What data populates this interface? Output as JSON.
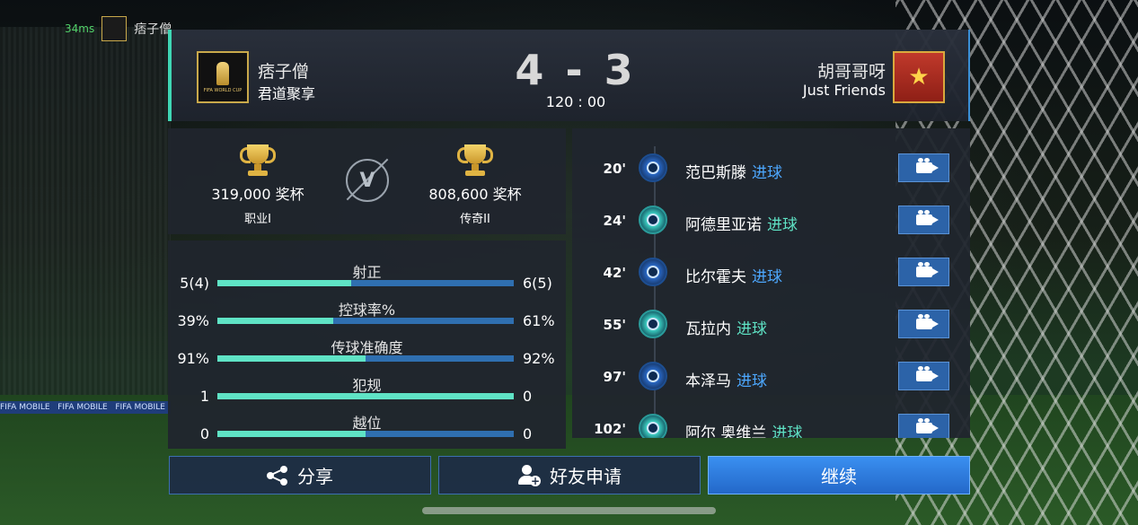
{
  "status": {
    "ping": "34ms",
    "mini_player": "痞子僧"
  },
  "match": {
    "home": {
      "name": "痞子僧",
      "club": "君道聚享",
      "logo_icon": "world-cup-icon"
    },
    "away": {
      "name": "胡哥哥呀",
      "club": "Just Friends",
      "logo_icon": "red-star-crest-icon"
    },
    "score_home": "4",
    "score_sep": "-",
    "score_away": "3",
    "time": "120 : 00"
  },
  "trophies": {
    "home": {
      "value": "319,000 奖杯",
      "rank": "职业I"
    },
    "away": {
      "value": "808,600 奖杯",
      "rank": "传奇II"
    },
    "vs_label": "V"
  },
  "stats": [
    {
      "title": "射正",
      "home": "5(4)",
      "away": "6(5)",
      "home_share": 0.45
    },
    {
      "title": "控球率%",
      "home": "39%",
      "away": "61%",
      "home_share": 0.39
    },
    {
      "title": "传球准确度",
      "home": "91%",
      "away": "92%",
      "home_share": 0.5
    },
    {
      "title": "犯规",
      "home": "1",
      "away": "0",
      "home_share": 1.0
    },
    {
      "title": "越位",
      "home": "0",
      "away": "0",
      "home_share": 0.5
    }
  ],
  "goals": [
    {
      "minute": "20'",
      "player": "范巴斯滕",
      "type": "进球",
      "side": "home"
    },
    {
      "minute": "24'",
      "player": "阿德里亚诺",
      "type": "进球",
      "side": "away"
    },
    {
      "minute": "42'",
      "player": "比尔霍夫",
      "type": "进球",
      "side": "home"
    },
    {
      "minute": "55'",
      "player": "瓦拉内",
      "type": "进球",
      "side": "away"
    },
    {
      "minute": "97'",
      "player": "本泽马",
      "type": "进球",
      "side": "home"
    },
    {
      "minute": "102'",
      "player": "阿尔 奥维兰",
      "type": "进球",
      "side": "away"
    }
  ],
  "buttons": {
    "share": "分享",
    "friend": "好友申请",
    "continue": "继续"
  },
  "colors": {
    "accent_teal": "#5fe3c5",
    "accent_blue": "#2f6fb0",
    "continue_blue": "#2f7fe0"
  }
}
